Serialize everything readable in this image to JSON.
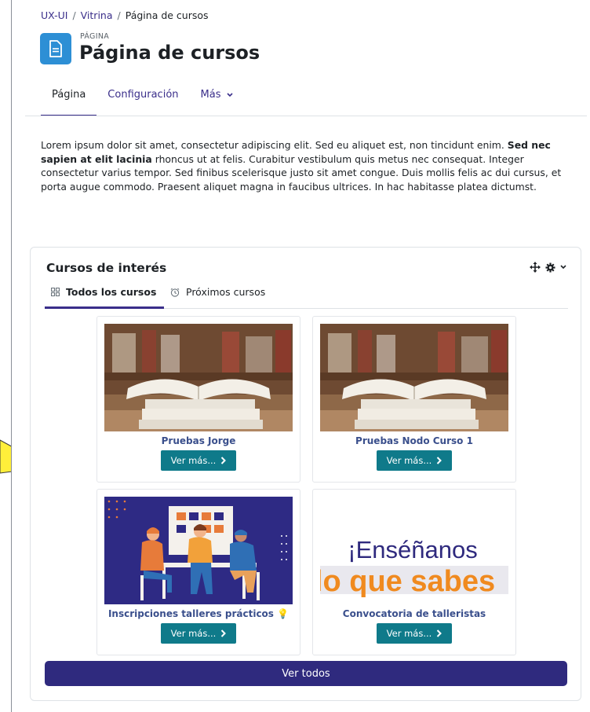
{
  "breadcrumb": [
    {
      "label": "UX-UI"
    },
    {
      "label": "Vitrina"
    },
    {
      "label": "Página de cursos"
    }
  ],
  "header": {
    "kicker": "PÁGINA",
    "title": "Página de cursos"
  },
  "tabs": [
    {
      "label": "Página",
      "active": true
    },
    {
      "label": "Configuración"
    },
    {
      "label": "Más"
    }
  ],
  "intro": {
    "part1": "Lorem ipsum dolor sit amet, consectetur adipiscing elit. Sed eu aliquet est, non tincidunt enim. ",
    "bold": "Sed nec sapien at elit lacinia",
    "part2": " rhoncus ut at felis. Curabitur vestibulum quis metus nec consequat. Integer consectetur varius tempor. Sed finibus scelerisque justo sit amet congue. Duis mollis felis ac dui cursus, et porta augue commodo. Praesent aliquet magna in faucibus ultrices. In hac habitasse platea dictumst."
  },
  "block": {
    "title": "Cursos de interés",
    "tabs": [
      {
        "label": "Todos los cursos",
        "icon": "grid-icon",
        "active": true
      },
      {
        "label": "Próximos cursos",
        "icon": "clock-icon"
      }
    ],
    "courses": [
      {
        "name": "Pruebas Jorge",
        "button": "Ver más...",
        "image": "books"
      },
      {
        "name": "Pruebas Nodo Curso 1",
        "button": "Ver más...",
        "image": "books"
      },
      {
        "name": "Inscripciones talleres prácticos 💡",
        "button": "Ver más...",
        "image": "meeting"
      },
      {
        "name": "Convocatoria de talleristas",
        "button": "Ver más...",
        "image": "teach",
        "image_text": {
          "line1": "¡Enséñanos",
          "line2": "lo que sabes"
        }
      }
    ],
    "view_all": "Ver todos"
  },
  "colors": {
    "primary": "#3a2e8a",
    "button_teal": "#0f7a8a",
    "view_all_bg": "#2f2a7e",
    "page_icon_bg": "#2d8fd5",
    "callout_yellow": "#ffef3a"
  }
}
